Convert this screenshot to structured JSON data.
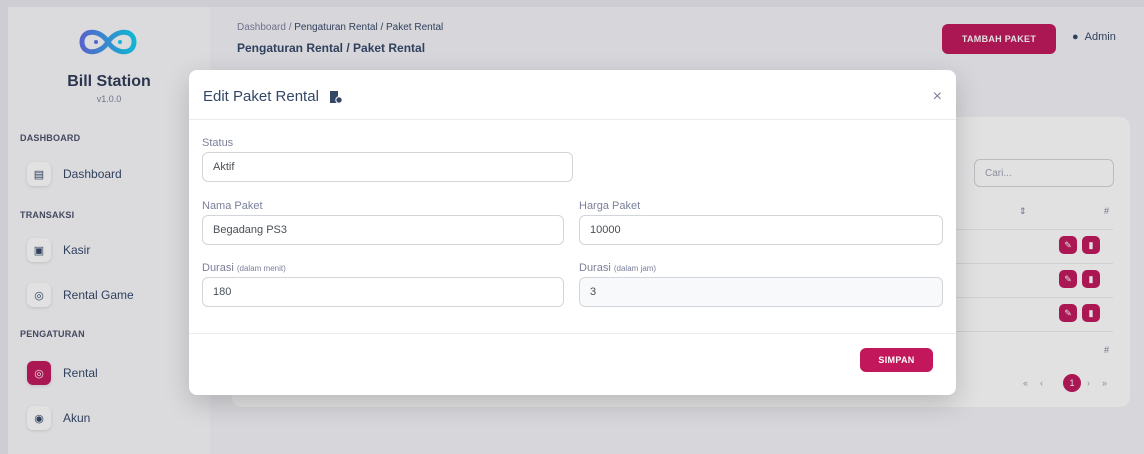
{
  "sidebar": {
    "brand": "Bill Station",
    "version": "v1.0.0",
    "sections": {
      "dashboard": "DASHBOARD",
      "transaksi": "TRANSAKSI",
      "pengaturan": "PENGATURAN"
    },
    "items": [
      {
        "label": "Dashboard",
        "icon": "store-icon"
      },
      {
        "label": "Kasir",
        "icon": "cashier-icon"
      },
      {
        "label": "Rental Game",
        "icon": "gamepad-icon"
      },
      {
        "label": "Rental",
        "icon": "gamepad-icon",
        "active": true
      },
      {
        "label": "Akun",
        "icon": "user-circle-icon"
      }
    ]
  },
  "header": {
    "breadcrumb_root": "Dashboard",
    "breadcrumb_separator": "/",
    "breadcrumb_current": "Pengaturan Rental / Paket Rental",
    "title": "Pengaturan Rental / Paket Rental",
    "add_button": "TAMBAH PAKET",
    "user": "Admin"
  },
  "table": {
    "search_placeholder": "Cari...",
    "col_hash": "#",
    "pagination": {
      "prev_first": "«",
      "prev": "‹",
      "current": "1",
      "next": "›",
      "next_last": "»"
    }
  },
  "modal": {
    "title": "Edit Paket Rental",
    "close": "×",
    "fields": {
      "status": {
        "label": "Status",
        "value": "Aktif"
      },
      "nama": {
        "label": "Nama Paket",
        "value": "Begadang PS3"
      },
      "harga": {
        "label": "Harga Paket",
        "value": "10000"
      },
      "durasi_menit": {
        "label": "Durasi",
        "hint": "(dalam menit)",
        "value": "180"
      },
      "durasi_jam": {
        "label": "Durasi",
        "hint": "(dalam jam)",
        "value": "3"
      }
    },
    "save_button": "SIMPAN"
  },
  "colors": {
    "accent": "#c2185b",
    "text": "#344767",
    "muted": "#7b809a"
  }
}
